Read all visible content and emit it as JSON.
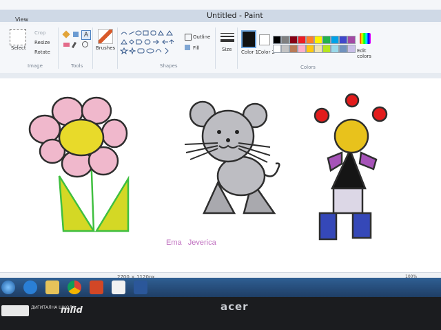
{
  "window": {
    "title": "Untitled - Paint"
  },
  "menu": {
    "view": "View"
  },
  "ribbon": {
    "image": {
      "label": "Image",
      "select": "Select",
      "crop": "Crop",
      "resize": "Resize",
      "rotate": "Rotate"
    },
    "tools": {
      "label": "Tools"
    },
    "brushes": {
      "label": "Brushes"
    },
    "shapes": {
      "label": "Shapes",
      "outline": "Outline",
      "fill": "Fill"
    },
    "size": {
      "label": "Size"
    },
    "colors": {
      "label": "Colors",
      "color1": "Color 1",
      "color2": "Color 2",
      "edit": "Edit colors"
    }
  },
  "palette": {
    "row1": [
      "#000000",
      "#7f7f7f",
      "#880015",
      "#ed1c24",
      "#ff7f27",
      "#fff200",
      "#22b14c",
      "#00a2e8",
      "#3f48cc",
      "#a349a4"
    ],
    "row2": [
      "#ffffff",
      "#c3c3c3",
      "#b97a57",
      "#ffaec9",
      "#ffc90e",
      "#efe4b0",
      "#b5e61d",
      "#99d9ea",
      "#7092be",
      "#c8bfe7"
    ]
  },
  "canvas": {
    "signature": "Ema   Jeverica",
    "signature_color": "#c070c0"
  },
  "status": {
    "dimensions": "2700 × 1120px",
    "zoom": "100%"
  },
  "monitor": {
    "brand": "acer",
    "sticker": "ДИГИТАЛНА ШКОЛА",
    "sticker_brand": "mlid"
  }
}
